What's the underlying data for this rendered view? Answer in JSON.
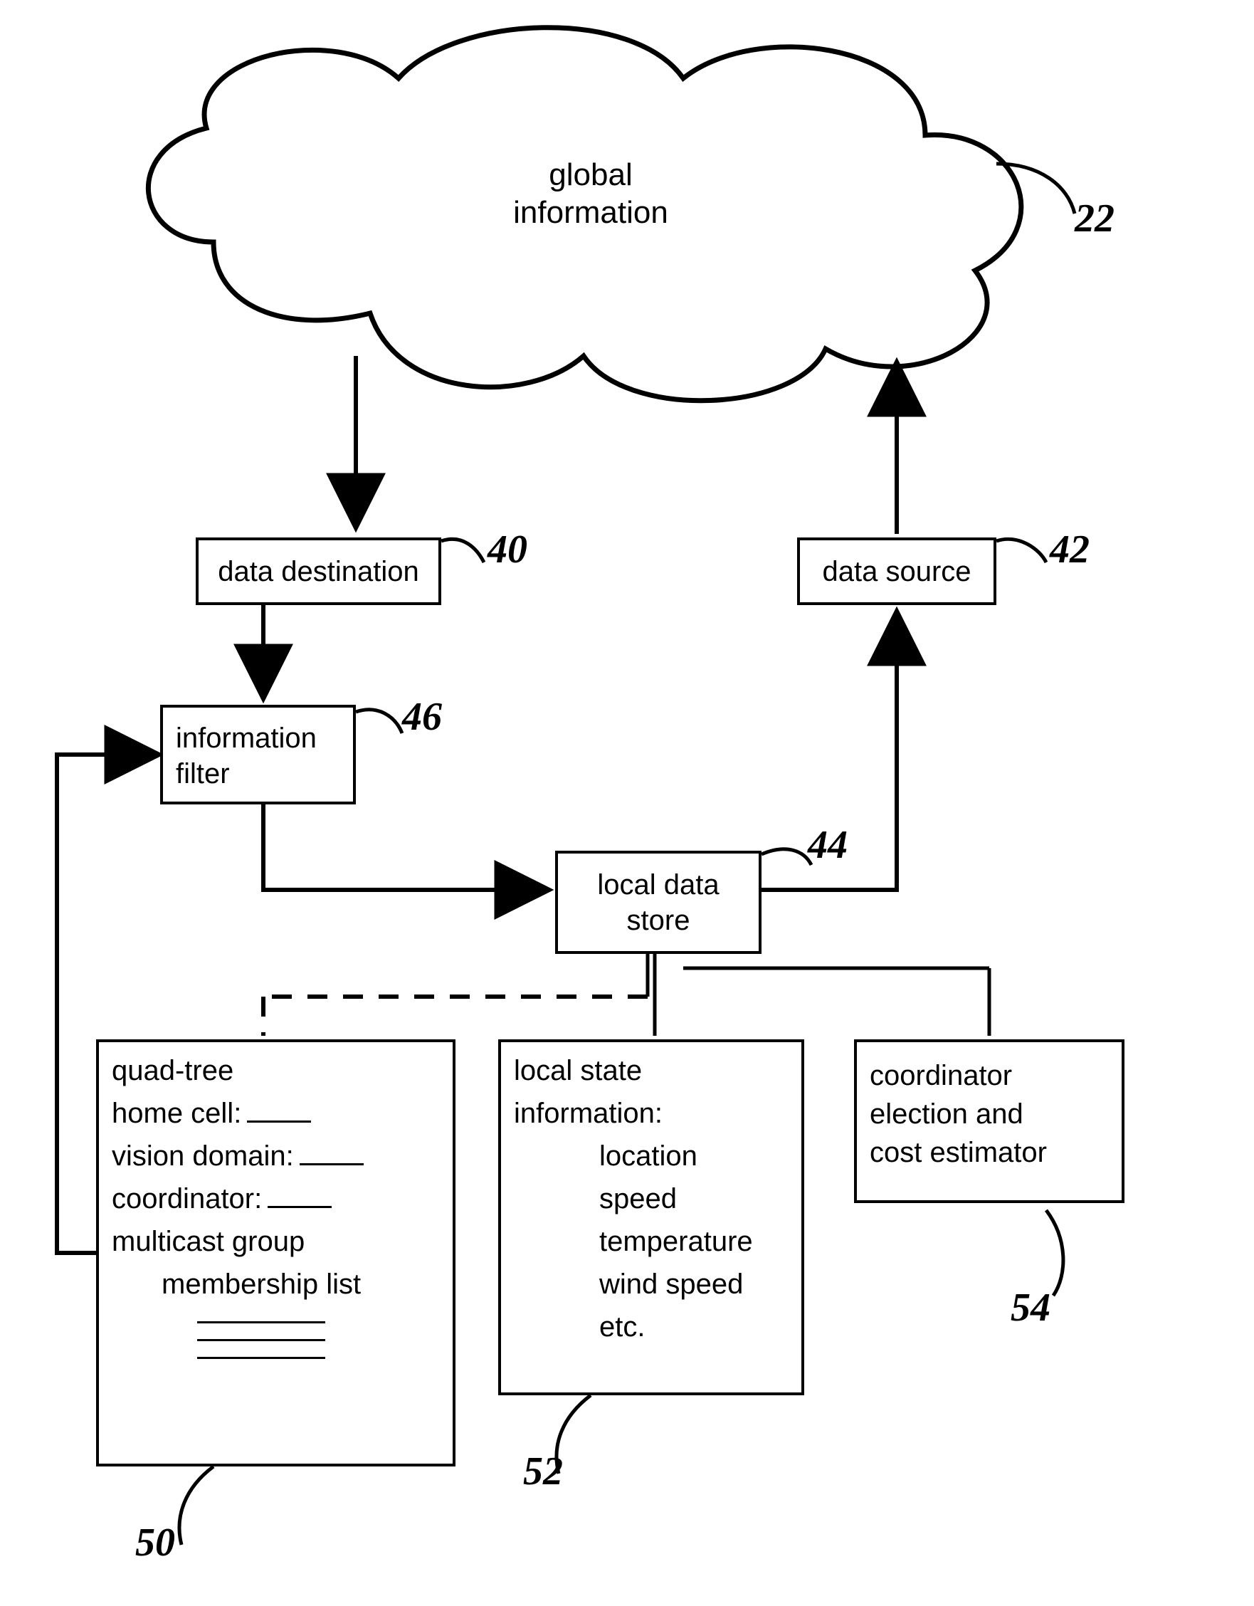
{
  "cloud": {
    "line1": "global",
    "line2": "information",
    "ref": "22"
  },
  "dataDestination": {
    "label": "data destination",
    "ref": "40"
  },
  "dataSource": {
    "label": "data source",
    "ref": "42"
  },
  "infoFilter": {
    "line1": "information",
    "line2": "filter",
    "ref": "46"
  },
  "localDataStore": {
    "line1": "local data",
    "line2": "store",
    "ref": "44"
  },
  "quadTree": {
    "ref": "50",
    "l1": "quad-tree",
    "l2": "home cell:",
    "l3": "vision domain:",
    "l4": "coordinator:",
    "l5": "multicast group",
    "l6": "membership list"
  },
  "localState": {
    "ref": "52",
    "l1": "local state",
    "l2": "information:",
    "l3": "location",
    "l4": "speed",
    "l5": "temperature",
    "l6": "wind speed",
    "l7": "etc."
  },
  "coordinator": {
    "ref": "54",
    "l1": "coordinator",
    "l2": "election and",
    "l3": "cost estimator"
  }
}
